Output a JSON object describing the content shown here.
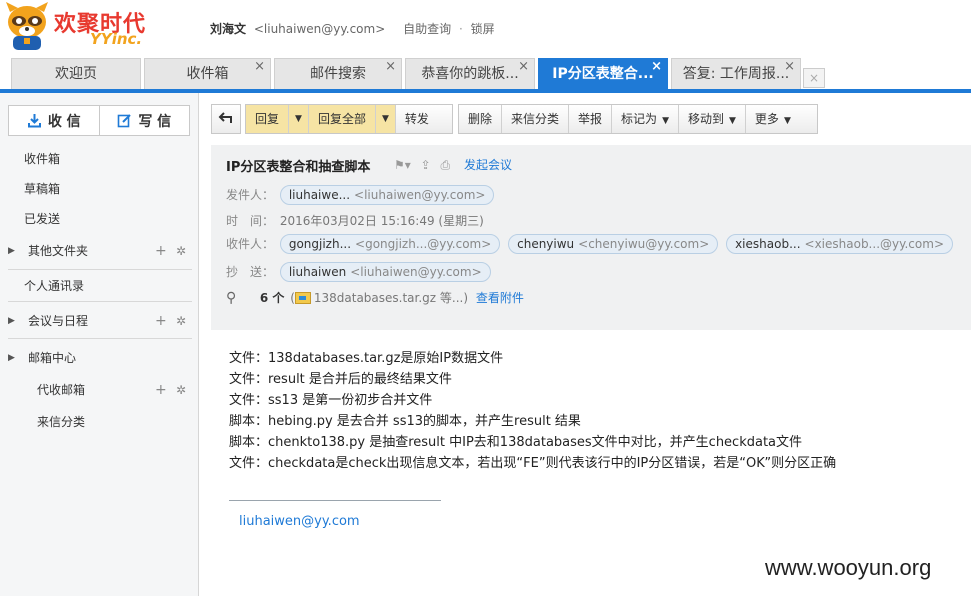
{
  "brand": {
    "logo_text": "欢聚时代",
    "logo_sub": "YYinc.",
    "mascot_icon": "raccoon-mascot-icon",
    "brand_red": "#e8392f",
    "brand_orange": "#f2a31d"
  },
  "user": {
    "name": "刘海文",
    "email": "<liuhaiwen@yy.com>",
    "link_query": "自助查询",
    "separator": "·",
    "link_lock": "锁屏"
  },
  "tabs": [
    {
      "label": "欢迎页",
      "active": false,
      "closable": false
    },
    {
      "label": "收件箱",
      "active": false,
      "closable": true
    },
    {
      "label": "邮件搜索",
      "active": false,
      "closable": true
    },
    {
      "label": "恭喜你的跳板...",
      "active": false,
      "closable": true
    },
    {
      "label": "IP分区表整合...",
      "active": true,
      "closable": true
    },
    {
      "label": "答复: 工作周报...",
      "active": false,
      "closable": true
    }
  ],
  "tab_close_glyph": "×",
  "accent_color": "#1f7ad6",
  "sidebar": {
    "receive_label": "收 信",
    "write_label": "写 信",
    "items": [
      {
        "label": "收件箱"
      },
      {
        "label": "草稿箱"
      },
      {
        "label": "已发送"
      },
      {
        "label": "其他文件夹"
      },
      {
        "label": "个人通讯录"
      },
      {
        "label": "会议与日程"
      },
      {
        "label": "邮箱中心"
      },
      {
        "label": "代收邮箱"
      },
      {
        "label": "来信分类"
      }
    ]
  },
  "toolbar": {
    "back_icon": "back-arrow-icon",
    "reply": "回复",
    "reply_all": "回复全部",
    "forward": "转发",
    "delete": "删除",
    "classify": "来信分类",
    "report": "举报",
    "mark_as": "标记为",
    "move_to": "移动到",
    "more": "更多"
  },
  "mail": {
    "subject": "IP分区表整合和抽查脚本",
    "start_meeting": "发起会议",
    "from_label": "发件人：",
    "from": [
      {
        "name": "liuhaiwe...",
        "addr": "<liuhaiwen@yy.com>"
      }
    ],
    "time_label": "时　间：",
    "time": "2016年03月02日 15:16:49 (星期三)",
    "to_label": "收件人：",
    "to": [
      {
        "name": "gongjizh...",
        "addr": "<gongjizh...@yy.com>"
      },
      {
        "name": "chenyiwu",
        "addr": "<chenyiwu@yy.com>"
      },
      {
        "name": "xieshaob...",
        "addr": "<xieshaob...@yy.com>"
      }
    ],
    "cc_label": "抄　送：",
    "cc": [
      {
        "name": "liuhaiwen",
        "addr": "<liuhaiwen@yy.com>"
      }
    ],
    "attach_count": "6 个",
    "attach_paren_open": "(",
    "attach_name": "138databases.tar.gz 等...)",
    "attach_link": "查看附件",
    "body_lines": [
      "文件：138databases.tar.gz是原始IP数据文件",
      "文件：result 是合并后的最终结果文件",
      "文件：ss13 是第一份初步合并文件",
      "脚本：hebing.py 是去合并 ss13的脚本，并产生result 结果",
      "脚本：chenkto138.py 是抽查result 中IP去和138databases文件中对比，并产生checkdata文件",
      "文件：checkdata是check出现信息文本，若出现“FE”则代表该行中的IP分区错误，若是“OK”则分区正确"
    ],
    "signature": "liuhaiwen@yy.com"
  },
  "watermark": "www.wooyun.org"
}
